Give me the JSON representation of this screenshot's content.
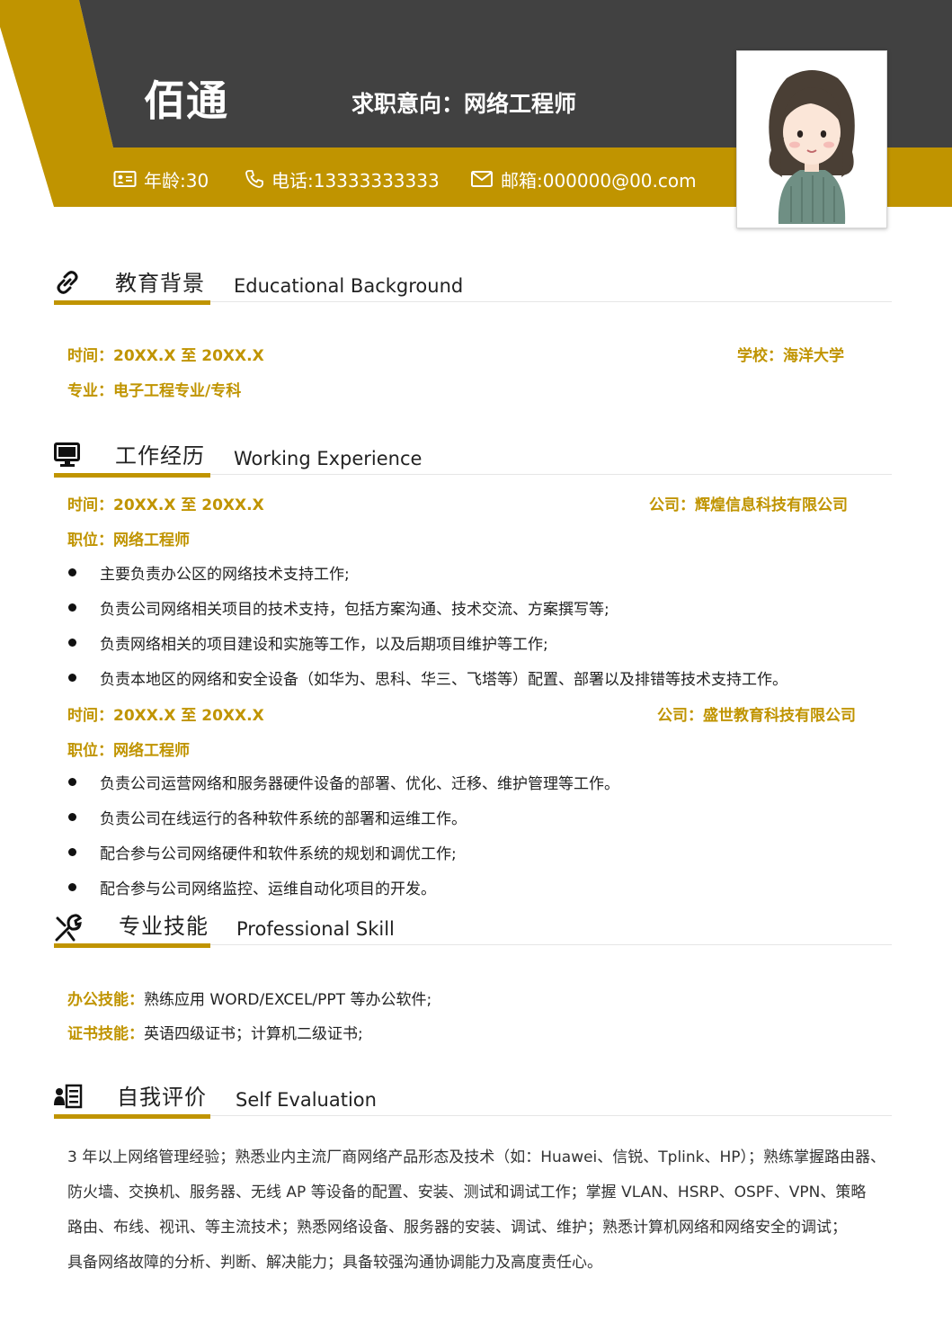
{
  "header": {
    "name": "佰通",
    "job_intent": "求职意向：网络工程师",
    "age": "年龄:30",
    "phone": "电话:13333333333",
    "email": "邮箱:000000@00.com",
    "icons": [
      "id-card-icon",
      "phone-icon",
      "mail-icon"
    ]
  },
  "colors": {
    "accent": "#c09400",
    "dark": "#414141"
  },
  "education": {
    "title_cn": "教育背景",
    "title_en": "Educational Background",
    "time": "时间：20XX.X 至 20XX.X",
    "school": "学校：海洋大学",
    "major": "专业：电子工程专业/专科"
  },
  "work": {
    "title_cn": "工作经历",
    "title_en": "Working Experience",
    "jobs": [
      {
        "time": "时间：20XX.X 至 20XX.X",
        "company": "公司：辉煌信息科技有限公司",
        "position": "职位：网络工程师",
        "duties": [
          "主要负责办公区的网络技术支持工作;",
          "负责公司网络相关项目的技术支持，包括方案沟通、技术交流、方案撰写等;",
          "负责网络相关的项目建设和实施等工作，以及后期项目维护等工作;",
          "负责本地区的网络和安全设备（如华为、思科、华三、飞塔等）配置、部署以及排错等技术支持工作。"
        ]
      },
      {
        "time": "时间：20XX.X 至 20XX.X",
        "company": "公司：盛世教育科技有限公司",
        "position": "职位：网络工程师",
        "duties": [
          "负责公司运营网络和服务器硬件设备的部署、优化、迁移、维护管理等工作。",
          "负责公司在线运行的各种软件系统的部署和运维工作。",
          "配合参与公司网络硬件和软件系统的规划和调优工作;",
          "配合参与公司网络监控、运维自动化项目的开发。"
        ]
      }
    ]
  },
  "skills": {
    "title_cn": "专业技能",
    "title_en": "Professional Skill",
    "office_key": "办公技能：",
    "office_val": "熟练应用 WORD/EXCEL/PPT 等办公软件;",
    "cert_key": "证书技能：",
    "cert_val": "英语四级证书；计算机二级证书;"
  },
  "evaluation": {
    "title_cn": "自我评价",
    "title_en": "Self Evaluation",
    "lines": [
      "3 年以上网络管理经验；熟悉业内主流厂商网络产品形态及技术（如：Huawei、信锐、Tplink、HP）；熟练掌握路由器、",
      "防火墙、交换机、服务器、无线 AP 等设备的配置、安装、测试和调试工作；掌握 VLAN、HSRP、OSPF、VPN、策略",
      "路由、布线、视讯、等主流技术；熟悉网络设备、服务器的安装、调试、维护；熟悉计算机网络和网络安全的调试；",
      "具备网络故障的分析、判断、解决能力；具备较强沟通协调能力及高度责任心。"
    ]
  }
}
